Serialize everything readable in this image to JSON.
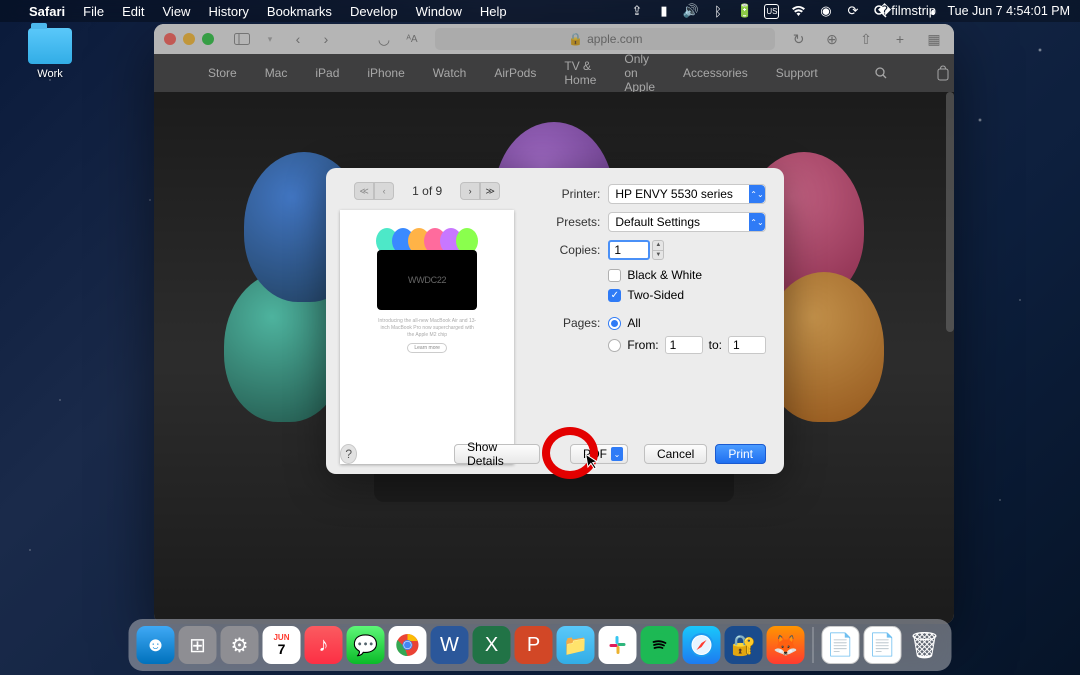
{
  "menubar": {
    "app": "Safari",
    "items": [
      "File",
      "Edit",
      "View",
      "History",
      "Bookmarks",
      "Develop",
      "Window",
      "Help"
    ],
    "clock": "Tue Jun 7  4:54:01 PM"
  },
  "desktop": {
    "folder_label": "Work"
  },
  "safari": {
    "url": "apple.com",
    "nav": [
      "Store",
      "Mac",
      "iPad",
      "iPhone",
      "Watch",
      "AirPods",
      "TV & Home",
      "Only on Apple",
      "Accessories",
      "Support"
    ]
  },
  "print": {
    "page_counter": "1 of 9",
    "thumb_wwdc": "WWDC22",
    "printer_label": "Printer:",
    "printer_value": "HP ENVY 5530 series",
    "presets_label": "Presets:",
    "presets_value": "Default Settings",
    "copies_label": "Copies:",
    "copies_value": "1",
    "bw_label": "Black & White",
    "twosided_label": "Two-Sided",
    "pages_label": "Pages:",
    "pages_all": "All",
    "pages_from_label": "From:",
    "pages_from": "1",
    "pages_to_label": "to:",
    "pages_to": "1",
    "help": "?",
    "show_details": "Show Details",
    "pdf": "PDF",
    "cancel": "Cancel",
    "print_btn": "Print"
  },
  "dock": {
    "cal_month": "JUN",
    "cal_day": "7"
  }
}
